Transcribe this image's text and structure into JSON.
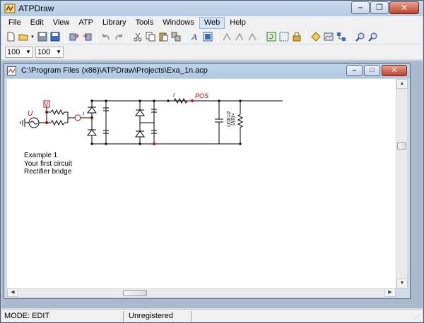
{
  "app": {
    "title": "ATPDraw"
  },
  "menu": {
    "items": [
      {
        "label": "File"
      },
      {
        "label": "Edit"
      },
      {
        "label": "View"
      },
      {
        "label": "ATP"
      },
      {
        "label": "Library"
      },
      {
        "label": "Tools"
      },
      {
        "label": "Windows"
      },
      {
        "label": "Web"
      },
      {
        "label": "Help"
      }
    ],
    "active": "Web"
  },
  "zoom": {
    "value_1": "100",
    "value_2": "100"
  },
  "child_window": {
    "title": "C:\\Program Files (x86)\\ATPDraw\\Projects\\Exa_1n.acp"
  },
  "circuit": {
    "source_label": "U",
    "probe_label": "V",
    "node_label": "POS",
    "current_label_1": "I",
    "current_label_2": "I",
    "cap_label": "U(0)=0",
    "load_label": "U(0)="
  },
  "notes": {
    "line1": "Example 1",
    "line2": "Your first circuit",
    "line3": "Rectifier bridge"
  },
  "status": {
    "mode": "MODE: EDIT",
    "registration": "Unregistered"
  },
  "colors": {
    "node_red": "#d01010",
    "label_red": "#c00000",
    "wire": "#000000"
  }
}
